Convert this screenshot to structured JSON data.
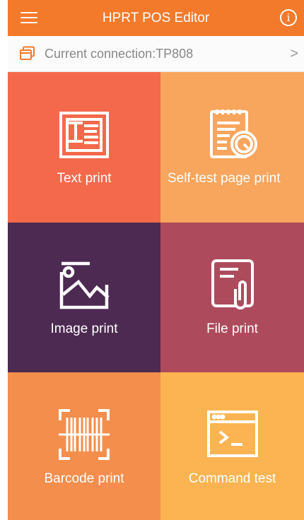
{
  "header": {
    "title": "HPRT POS Editor",
    "menu_icon": "hamburger-menu-icon",
    "info_icon": "info-icon",
    "info_glyph": "i"
  },
  "connection": {
    "label": "Current connection:TP808",
    "icon": "printer-connection-icon",
    "chevron": ">"
  },
  "tiles": [
    {
      "label": "Text print",
      "icon": "text-document-icon",
      "color": "#f4694b"
    },
    {
      "label": "Self-test page print",
      "icon": "self-test-clipboard-icon",
      "color": "#f8a55d"
    },
    {
      "label": "Image print",
      "icon": "image-icon",
      "color": "#4d2a52"
    },
    {
      "label": "File print",
      "icon": "file-attachment-icon",
      "color": "#ad4b5c"
    },
    {
      "label": "Barcode print",
      "icon": "barcode-scan-icon",
      "color": "#f48e4c"
    },
    {
      "label": "Command test",
      "icon": "terminal-window-icon",
      "color": "#fbb451"
    }
  ],
  "colors": {
    "header": "#f47a2b",
    "icon_stroke": "#ffffff"
  }
}
